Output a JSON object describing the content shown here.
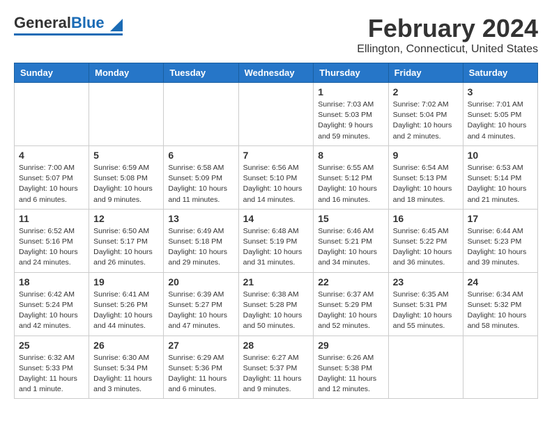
{
  "header": {
    "logo_general": "General",
    "logo_blue": "Blue",
    "title": "February 2024",
    "subtitle": "Ellington, Connecticut, United States"
  },
  "weekdays": [
    "Sunday",
    "Monday",
    "Tuesday",
    "Wednesday",
    "Thursday",
    "Friday",
    "Saturday"
  ],
  "weeks": [
    [
      {
        "day": "",
        "info": ""
      },
      {
        "day": "",
        "info": ""
      },
      {
        "day": "",
        "info": ""
      },
      {
        "day": "",
        "info": ""
      },
      {
        "day": "1",
        "info": "Sunrise: 7:03 AM\nSunset: 5:03 PM\nDaylight: 9 hours\nand 59 minutes."
      },
      {
        "day": "2",
        "info": "Sunrise: 7:02 AM\nSunset: 5:04 PM\nDaylight: 10 hours\nand 2 minutes."
      },
      {
        "day": "3",
        "info": "Sunrise: 7:01 AM\nSunset: 5:05 PM\nDaylight: 10 hours\nand 4 minutes."
      }
    ],
    [
      {
        "day": "4",
        "info": "Sunrise: 7:00 AM\nSunset: 5:07 PM\nDaylight: 10 hours\nand 6 minutes."
      },
      {
        "day": "5",
        "info": "Sunrise: 6:59 AM\nSunset: 5:08 PM\nDaylight: 10 hours\nand 9 minutes."
      },
      {
        "day": "6",
        "info": "Sunrise: 6:58 AM\nSunset: 5:09 PM\nDaylight: 10 hours\nand 11 minutes."
      },
      {
        "day": "7",
        "info": "Sunrise: 6:56 AM\nSunset: 5:10 PM\nDaylight: 10 hours\nand 14 minutes."
      },
      {
        "day": "8",
        "info": "Sunrise: 6:55 AM\nSunset: 5:12 PM\nDaylight: 10 hours\nand 16 minutes."
      },
      {
        "day": "9",
        "info": "Sunrise: 6:54 AM\nSunset: 5:13 PM\nDaylight: 10 hours\nand 18 minutes."
      },
      {
        "day": "10",
        "info": "Sunrise: 6:53 AM\nSunset: 5:14 PM\nDaylight: 10 hours\nand 21 minutes."
      }
    ],
    [
      {
        "day": "11",
        "info": "Sunrise: 6:52 AM\nSunset: 5:16 PM\nDaylight: 10 hours\nand 24 minutes."
      },
      {
        "day": "12",
        "info": "Sunrise: 6:50 AM\nSunset: 5:17 PM\nDaylight: 10 hours\nand 26 minutes."
      },
      {
        "day": "13",
        "info": "Sunrise: 6:49 AM\nSunset: 5:18 PM\nDaylight: 10 hours\nand 29 minutes."
      },
      {
        "day": "14",
        "info": "Sunrise: 6:48 AM\nSunset: 5:19 PM\nDaylight: 10 hours\nand 31 minutes."
      },
      {
        "day": "15",
        "info": "Sunrise: 6:46 AM\nSunset: 5:21 PM\nDaylight: 10 hours\nand 34 minutes."
      },
      {
        "day": "16",
        "info": "Sunrise: 6:45 AM\nSunset: 5:22 PM\nDaylight: 10 hours\nand 36 minutes."
      },
      {
        "day": "17",
        "info": "Sunrise: 6:44 AM\nSunset: 5:23 PM\nDaylight: 10 hours\nand 39 minutes."
      }
    ],
    [
      {
        "day": "18",
        "info": "Sunrise: 6:42 AM\nSunset: 5:24 PM\nDaylight: 10 hours\nand 42 minutes."
      },
      {
        "day": "19",
        "info": "Sunrise: 6:41 AM\nSunset: 5:26 PM\nDaylight: 10 hours\nand 44 minutes."
      },
      {
        "day": "20",
        "info": "Sunrise: 6:39 AM\nSunset: 5:27 PM\nDaylight: 10 hours\nand 47 minutes."
      },
      {
        "day": "21",
        "info": "Sunrise: 6:38 AM\nSunset: 5:28 PM\nDaylight: 10 hours\nand 50 minutes."
      },
      {
        "day": "22",
        "info": "Sunrise: 6:37 AM\nSunset: 5:29 PM\nDaylight: 10 hours\nand 52 minutes."
      },
      {
        "day": "23",
        "info": "Sunrise: 6:35 AM\nSunset: 5:31 PM\nDaylight: 10 hours\nand 55 minutes."
      },
      {
        "day": "24",
        "info": "Sunrise: 6:34 AM\nSunset: 5:32 PM\nDaylight: 10 hours\nand 58 minutes."
      }
    ],
    [
      {
        "day": "25",
        "info": "Sunrise: 6:32 AM\nSunset: 5:33 PM\nDaylight: 11 hours\nand 1 minute."
      },
      {
        "day": "26",
        "info": "Sunrise: 6:30 AM\nSunset: 5:34 PM\nDaylight: 11 hours\nand 3 minutes."
      },
      {
        "day": "27",
        "info": "Sunrise: 6:29 AM\nSunset: 5:36 PM\nDaylight: 11 hours\nand 6 minutes."
      },
      {
        "day": "28",
        "info": "Sunrise: 6:27 AM\nSunset: 5:37 PM\nDaylight: 11 hours\nand 9 minutes."
      },
      {
        "day": "29",
        "info": "Sunrise: 6:26 AM\nSunset: 5:38 PM\nDaylight: 11 hours\nand 12 minutes."
      },
      {
        "day": "",
        "info": ""
      },
      {
        "day": "",
        "info": ""
      }
    ]
  ]
}
